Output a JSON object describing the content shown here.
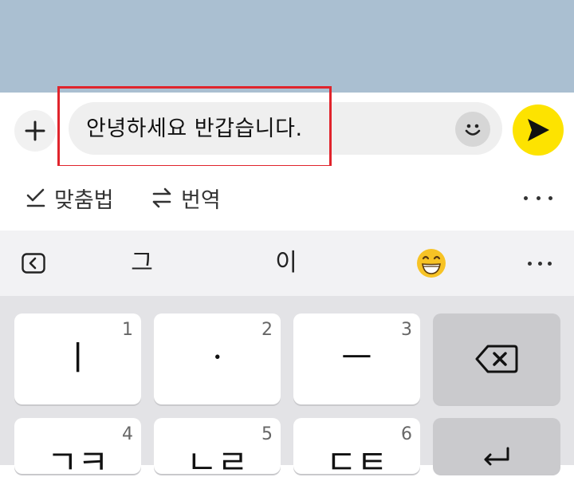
{
  "input": {
    "message": "안녕하세요 반갑습니다."
  },
  "toolbar": {
    "spellcheck_label": "맞춤법",
    "translate_label": "번역"
  },
  "suggestions": {
    "word_1": "그",
    "word_2": "이",
    "emoji_icon": "grinning-face-emoji"
  },
  "keyboard": {
    "keys": [
      {
        "num": "1",
        "char": "ㅣ"
      },
      {
        "num": "2",
        "char": "ㆍ"
      },
      {
        "num": "3",
        "char": "ㅡ"
      },
      {
        "num": "4",
        "char": "ㄱㅋ"
      },
      {
        "num": "5",
        "char": "ㄴㄹ"
      },
      {
        "num": "6",
        "char": "ㄷㅌ"
      }
    ]
  },
  "colors": {
    "chat_background": "#aabfd1",
    "send_button": "#fde300",
    "highlight_border": "#e0242c"
  }
}
